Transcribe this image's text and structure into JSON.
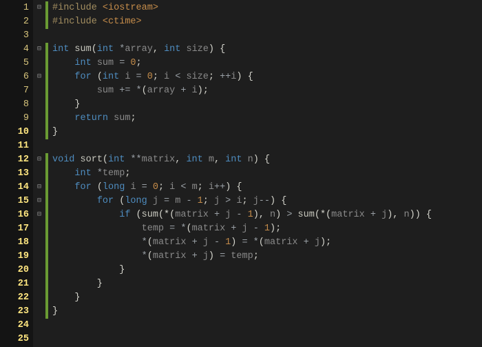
{
  "line_numbers": [
    "1",
    "2",
    "3",
    "4",
    "5",
    "6",
    "7",
    "8",
    "9",
    "10",
    "11",
    "12",
    "13",
    "14",
    "15",
    "16",
    "17",
    "18",
    "19",
    "20",
    "21",
    "22",
    "23",
    "24",
    "25"
  ],
  "fold_markers": [
    "⊟",
    "",
    "",
    "⊟",
    "",
    "⊟",
    "",
    "",
    "",
    "",
    "",
    "⊟",
    "",
    "⊟",
    "⊟",
    "⊟",
    "",
    "",
    "",
    "",
    "",
    "",
    "",
    "",
    ""
  ],
  "change_bar": [
    true,
    true,
    false,
    true,
    true,
    true,
    true,
    true,
    true,
    true,
    false,
    true,
    true,
    true,
    true,
    true,
    true,
    true,
    true,
    true,
    true,
    true,
    true,
    false,
    false
  ],
  "code": {
    "language": "cpp",
    "lines": [
      {
        "tokens": [
          {
            "t": "#include ",
            "c": "pp"
          },
          {
            "t": "<iostream>",
            "c": "hd"
          }
        ]
      },
      {
        "tokens": [
          {
            "t": "#include ",
            "c": "pp"
          },
          {
            "t": "<ctime>",
            "c": "hd"
          }
        ]
      },
      {
        "tokens": []
      },
      {
        "tokens": [
          {
            "t": "int ",
            "c": "kw"
          },
          {
            "t": "sum",
            "c": "fn"
          },
          {
            "t": "(",
            "c": "pn"
          },
          {
            "t": "int ",
            "c": "kw"
          },
          {
            "t": "*",
            "c": "op"
          },
          {
            "t": "array",
            "c": "id"
          },
          {
            "t": ", ",
            "c": "pn"
          },
          {
            "t": "int ",
            "c": "kw"
          },
          {
            "t": "size",
            "c": "id"
          },
          {
            "t": ") {",
            "c": "pn"
          }
        ]
      },
      {
        "tokens": [
          {
            "t": "    ",
            "c": ""
          },
          {
            "t": "int ",
            "c": "kw"
          },
          {
            "t": "sum ",
            "c": "id"
          },
          {
            "t": "= ",
            "c": "op"
          },
          {
            "t": "0",
            "c": "nm"
          },
          {
            "t": ";",
            "c": "pn"
          }
        ]
      },
      {
        "tokens": [
          {
            "t": "    ",
            "c": ""
          },
          {
            "t": "for ",
            "c": "kw"
          },
          {
            "t": "(",
            "c": "pn"
          },
          {
            "t": "int ",
            "c": "kw"
          },
          {
            "t": "i ",
            "c": "id"
          },
          {
            "t": "= ",
            "c": "op"
          },
          {
            "t": "0",
            "c": "nm"
          },
          {
            "t": "; ",
            "c": "pn"
          },
          {
            "t": "i ",
            "c": "id"
          },
          {
            "t": "< ",
            "c": "op"
          },
          {
            "t": "size",
            "c": "id"
          },
          {
            "t": "; ",
            "c": "pn"
          },
          {
            "t": "++",
            "c": "op"
          },
          {
            "t": "i",
            "c": "id"
          },
          {
            "t": ") {",
            "c": "pn"
          }
        ]
      },
      {
        "tokens": [
          {
            "t": "        ",
            "c": ""
          },
          {
            "t": "sum ",
            "c": "id"
          },
          {
            "t": "+= *",
            "c": "op"
          },
          {
            "t": "(",
            "c": "pn"
          },
          {
            "t": "array ",
            "c": "id"
          },
          {
            "t": "+ ",
            "c": "op"
          },
          {
            "t": "i",
            "c": "id"
          },
          {
            "t": ");",
            "c": "pn"
          }
        ]
      },
      {
        "tokens": [
          {
            "t": "    }",
            "c": "pn"
          }
        ]
      },
      {
        "tokens": [
          {
            "t": "    ",
            "c": ""
          },
          {
            "t": "return ",
            "c": "kw"
          },
          {
            "t": "sum",
            "c": "id"
          },
          {
            "t": ";",
            "c": "pn"
          }
        ]
      },
      {
        "tokens": [
          {
            "t": "}",
            "c": "pn"
          }
        ]
      },
      {
        "tokens": []
      },
      {
        "tokens": [
          {
            "t": "void ",
            "c": "kw"
          },
          {
            "t": "sort",
            "c": "fn"
          },
          {
            "t": "(",
            "c": "pn"
          },
          {
            "t": "int ",
            "c": "kw"
          },
          {
            "t": "**",
            "c": "op"
          },
          {
            "t": "matrix",
            "c": "id"
          },
          {
            "t": ", ",
            "c": "pn"
          },
          {
            "t": "int ",
            "c": "kw"
          },
          {
            "t": "m",
            "c": "id"
          },
          {
            "t": ", ",
            "c": "pn"
          },
          {
            "t": "int ",
            "c": "kw"
          },
          {
            "t": "n",
            "c": "id"
          },
          {
            "t": ") {",
            "c": "pn"
          }
        ]
      },
      {
        "tokens": [
          {
            "t": "    ",
            "c": ""
          },
          {
            "t": "int ",
            "c": "kw"
          },
          {
            "t": "*",
            "c": "op"
          },
          {
            "t": "temp",
            "c": "id"
          },
          {
            "t": ";",
            "c": "pn"
          }
        ]
      },
      {
        "tokens": [
          {
            "t": "    ",
            "c": ""
          },
          {
            "t": "for ",
            "c": "kw"
          },
          {
            "t": "(",
            "c": "pn"
          },
          {
            "t": "long ",
            "c": "kw"
          },
          {
            "t": "i ",
            "c": "id"
          },
          {
            "t": "= ",
            "c": "op"
          },
          {
            "t": "0",
            "c": "nm"
          },
          {
            "t": "; ",
            "c": "pn"
          },
          {
            "t": "i ",
            "c": "id"
          },
          {
            "t": "< ",
            "c": "op"
          },
          {
            "t": "m",
            "c": "id"
          },
          {
            "t": "; ",
            "c": "pn"
          },
          {
            "t": "i",
            "c": "id"
          },
          {
            "t": "++",
            "c": "op"
          },
          {
            "t": ") {",
            "c": "pn"
          }
        ]
      },
      {
        "tokens": [
          {
            "t": "        ",
            "c": ""
          },
          {
            "t": "for ",
            "c": "kw"
          },
          {
            "t": "(",
            "c": "pn"
          },
          {
            "t": "long ",
            "c": "kw"
          },
          {
            "t": "j ",
            "c": "id"
          },
          {
            "t": "= ",
            "c": "op"
          },
          {
            "t": "m ",
            "c": "id"
          },
          {
            "t": "- ",
            "c": "op"
          },
          {
            "t": "1",
            "c": "nm"
          },
          {
            "t": "; ",
            "c": "pn"
          },
          {
            "t": "j ",
            "c": "id"
          },
          {
            "t": "> ",
            "c": "op"
          },
          {
            "t": "i",
            "c": "id"
          },
          {
            "t": "; ",
            "c": "pn"
          },
          {
            "t": "j",
            "c": "id"
          },
          {
            "t": "--",
            "c": "op"
          },
          {
            "t": ") {",
            "c": "pn"
          }
        ]
      },
      {
        "tokens": [
          {
            "t": "            ",
            "c": ""
          },
          {
            "t": "if ",
            "c": "kw"
          },
          {
            "t": "(",
            "c": "pn"
          },
          {
            "t": "sum",
            "c": "fn"
          },
          {
            "t": "(*(",
            "c": "pn"
          },
          {
            "t": "matrix ",
            "c": "id"
          },
          {
            "t": "+ ",
            "c": "op"
          },
          {
            "t": "j ",
            "c": "id"
          },
          {
            "t": "- ",
            "c": "op"
          },
          {
            "t": "1",
            "c": "nm"
          },
          {
            "t": "), ",
            "c": "pn"
          },
          {
            "t": "n",
            "c": "id"
          },
          {
            "t": ") ",
            "c": "pn"
          },
          {
            "t": "> ",
            "c": "op"
          },
          {
            "t": "sum",
            "c": "fn"
          },
          {
            "t": "(*(",
            "c": "pn"
          },
          {
            "t": "matrix ",
            "c": "id"
          },
          {
            "t": "+ ",
            "c": "op"
          },
          {
            "t": "j",
            "c": "id"
          },
          {
            "t": "), ",
            "c": "pn"
          },
          {
            "t": "n",
            "c": "id"
          },
          {
            "t": ")) {",
            "c": "pn"
          }
        ]
      },
      {
        "tokens": [
          {
            "t": "                ",
            "c": ""
          },
          {
            "t": "temp ",
            "c": "id"
          },
          {
            "t": "= *",
            "c": "op"
          },
          {
            "t": "(",
            "c": "pn"
          },
          {
            "t": "matrix ",
            "c": "id"
          },
          {
            "t": "+ ",
            "c": "op"
          },
          {
            "t": "j ",
            "c": "id"
          },
          {
            "t": "- ",
            "c": "op"
          },
          {
            "t": "1",
            "c": "nm"
          },
          {
            "t": ");",
            "c": "pn"
          }
        ]
      },
      {
        "tokens": [
          {
            "t": "                *",
            "c": "op"
          },
          {
            "t": "(",
            "c": "pn"
          },
          {
            "t": "matrix ",
            "c": "id"
          },
          {
            "t": "+ ",
            "c": "op"
          },
          {
            "t": "j ",
            "c": "id"
          },
          {
            "t": "- ",
            "c": "op"
          },
          {
            "t": "1",
            "c": "nm"
          },
          {
            "t": ") ",
            "c": "pn"
          },
          {
            "t": "= *",
            "c": "op"
          },
          {
            "t": "(",
            "c": "pn"
          },
          {
            "t": "matrix ",
            "c": "id"
          },
          {
            "t": "+ ",
            "c": "op"
          },
          {
            "t": "j",
            "c": "id"
          },
          {
            "t": ");",
            "c": "pn"
          }
        ]
      },
      {
        "tokens": [
          {
            "t": "                *",
            "c": "op"
          },
          {
            "t": "(",
            "c": "pn"
          },
          {
            "t": "matrix ",
            "c": "id"
          },
          {
            "t": "+ ",
            "c": "op"
          },
          {
            "t": "j",
            "c": "id"
          },
          {
            "t": ") ",
            "c": "pn"
          },
          {
            "t": "= ",
            "c": "op"
          },
          {
            "t": "temp",
            "c": "id"
          },
          {
            "t": ";",
            "c": "pn"
          }
        ]
      },
      {
        "tokens": [
          {
            "t": "            }",
            "c": "pn"
          }
        ]
      },
      {
        "tokens": [
          {
            "t": "        }",
            "c": "pn"
          }
        ]
      },
      {
        "tokens": [
          {
            "t": "    }",
            "c": "pn"
          }
        ]
      },
      {
        "tokens": [
          {
            "t": "}",
            "c": "pn"
          }
        ]
      },
      {
        "tokens": []
      },
      {
        "tokens": []
      }
    ]
  }
}
